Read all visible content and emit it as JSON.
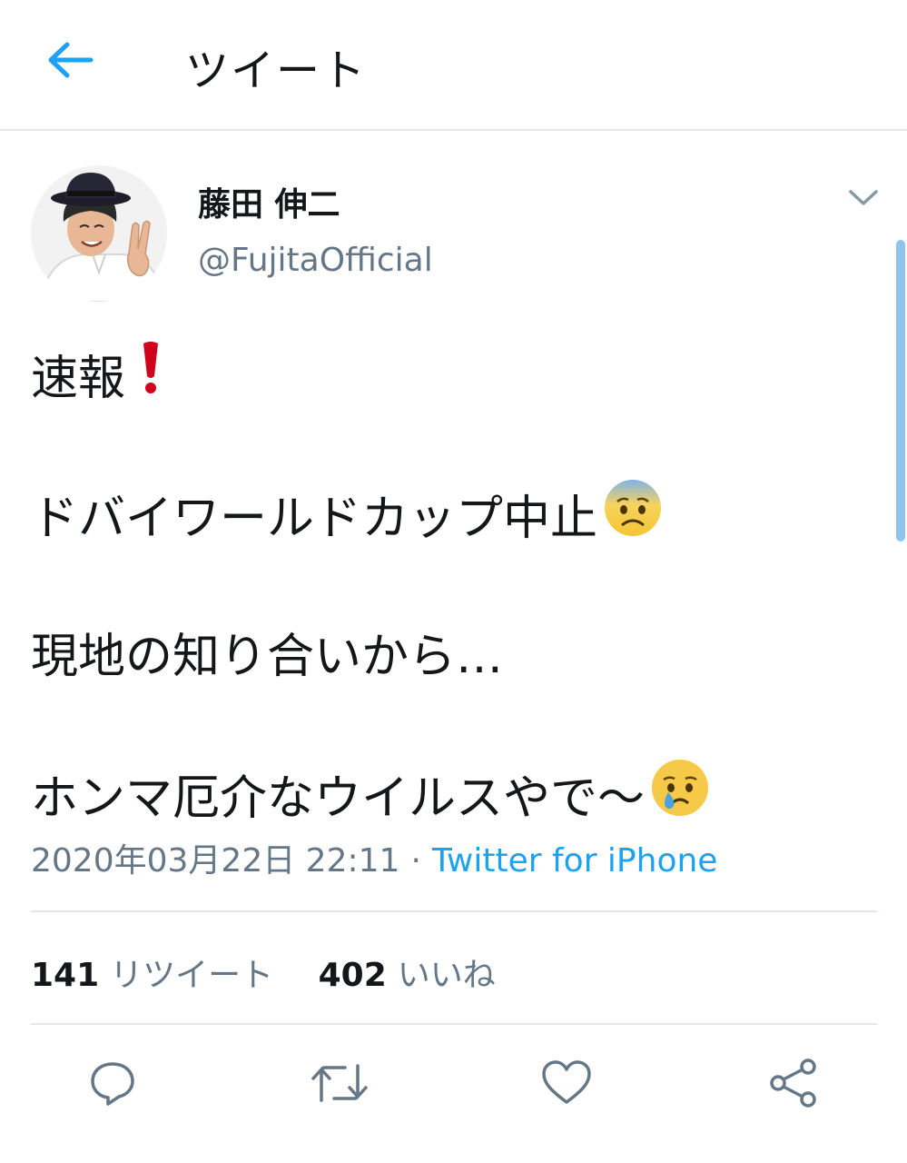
{
  "header": {
    "title": "ツイート",
    "back_icon": "arrow-left-icon"
  },
  "author": {
    "display_name": "藤田 伸二",
    "handle": "@FujitaOfficial"
  },
  "tweet": {
    "line1": "速報",
    "line2": "ドバイワールドカップ中止",
    "line3": "現地の知り合いから…",
    "line4": "ホンマ厄介なウイルスやで〜",
    "emojis": [
      "exclamation-icon",
      "anxious-face-icon",
      "crying-face-icon"
    ]
  },
  "meta": {
    "datetime": "2020年03月22日 22:11",
    "separator": "·",
    "source": "Twitter for iPhone"
  },
  "stats": {
    "retweets_count": "141",
    "retweets_label": "リツイート",
    "likes_count": "402",
    "likes_label": "いいね"
  },
  "actions": [
    "reply-icon",
    "retweet-icon",
    "like-icon",
    "share-icon"
  ],
  "colors": {
    "accent": "#1da1f2",
    "text": "#14171a",
    "secondary": "#657786",
    "divider": "#e1e8ed"
  }
}
